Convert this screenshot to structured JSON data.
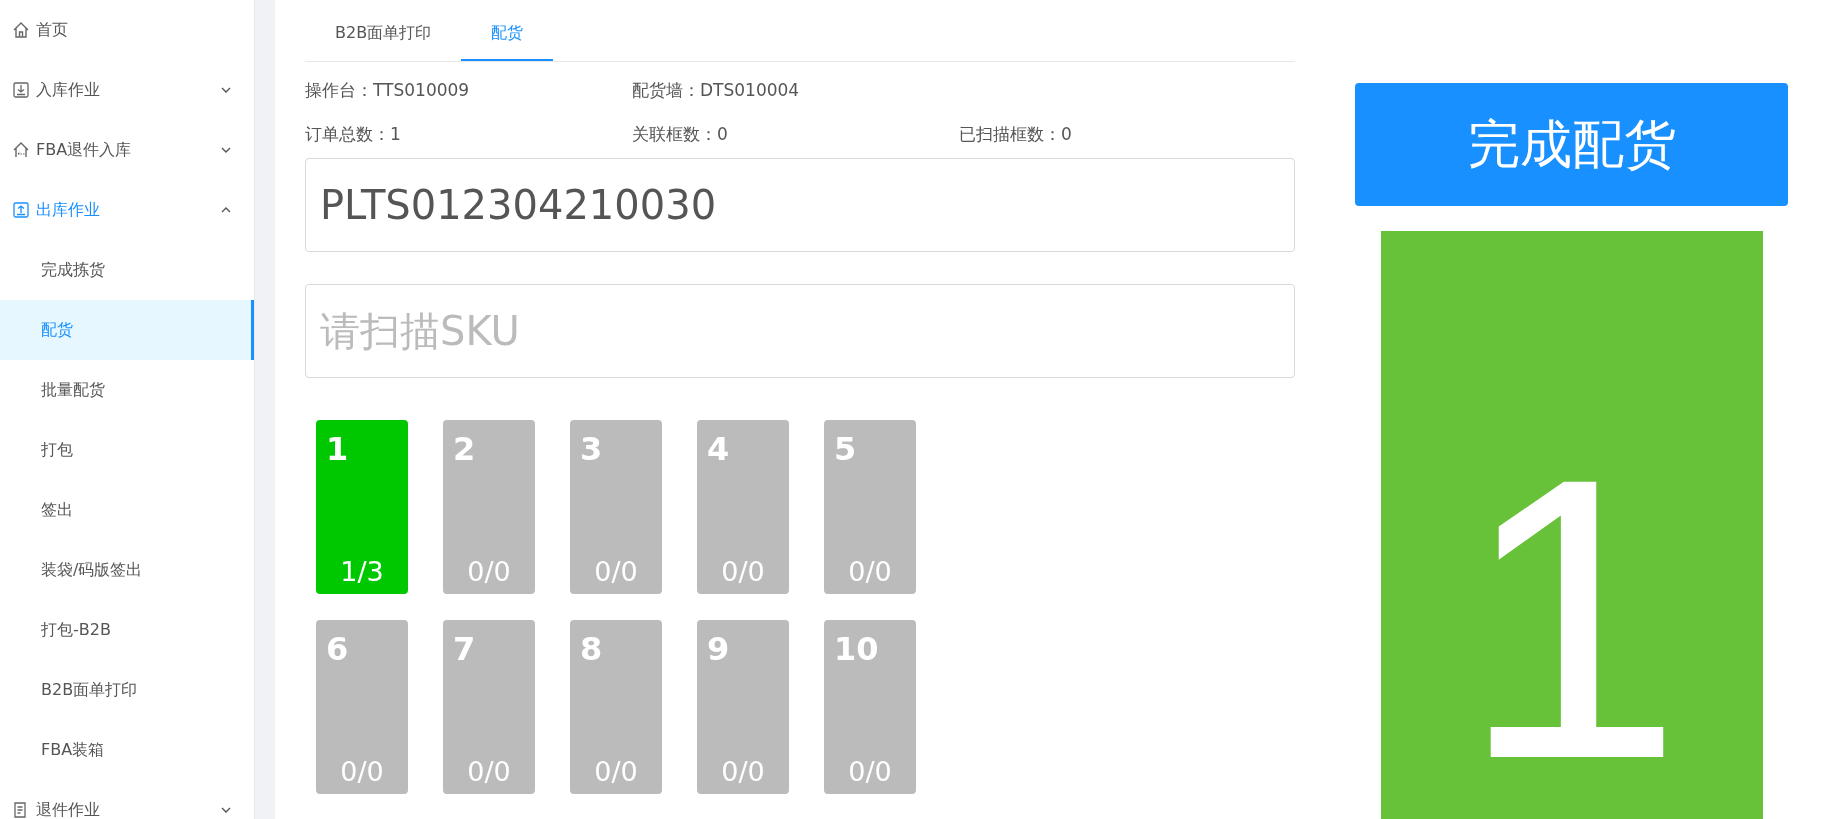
{
  "sidebar": {
    "items": [
      {
        "label": "首页",
        "kind": "link",
        "selected": false
      },
      {
        "label": "入库作业",
        "kind": "group",
        "expanded": false,
        "selected": false
      },
      {
        "label": "FBA退件入库",
        "kind": "group",
        "expanded": false,
        "selected": false
      },
      {
        "label": "出库作业",
        "kind": "group",
        "expanded": true,
        "selected": false,
        "children": [
          {
            "label": "完成拣货",
            "selected": false
          },
          {
            "label": "配货",
            "selected": true
          },
          {
            "label": "批量配货",
            "selected": false
          },
          {
            "label": "打包",
            "selected": false
          },
          {
            "label": "签出",
            "selected": false
          },
          {
            "label": "装袋/码版签出",
            "selected": false
          },
          {
            "label": "打包-B2B",
            "selected": false
          },
          {
            "label": "B2B面单打印",
            "selected": false
          },
          {
            "label": "FBA装箱",
            "selected": false
          }
        ]
      },
      {
        "label": "退件作业",
        "kind": "group",
        "expanded": false,
        "selected": false
      }
    ]
  },
  "tabs": [
    {
      "label": "B2B面单打印",
      "selected": false
    },
    {
      "label": "配货",
      "selected": true
    }
  ],
  "info": [
    [
      {
        "label": "操作台：",
        "value": "TTS010009"
      },
      {
        "label": "配货墙：",
        "value": "DTS010004"
      }
    ],
    [
      {
        "label": "订单总数：",
        "value": "1"
      },
      {
        "label": "关联框数：",
        "value": "0"
      },
      {
        "label": "已扫描框数：",
        "value": "0"
      }
    ]
  ],
  "container_field": {
    "value": "PLTS012304210030"
  },
  "sku_field": {
    "placeholder": "请扫描SKU"
  },
  "slots": [
    {
      "number": "1",
      "count": "1/3",
      "selected": true
    },
    {
      "number": "2",
      "count": "0/0",
      "selected": false
    },
    {
      "number": "3",
      "count": "0/0",
      "selected": false
    },
    {
      "number": "4",
      "count": "0/0",
      "selected": false
    },
    {
      "number": "5",
      "count": "0/0",
      "selected": false
    },
    {
      "number": "6",
      "count": "0/0",
      "selected": false
    },
    {
      "number": "7",
      "count": "0/0",
      "selected": false
    },
    {
      "number": "8",
      "count": "0/0",
      "selected": false
    },
    {
      "number": "9",
      "count": "0/0",
      "selected": false
    },
    {
      "number": "10",
      "count": "0/0",
      "selected": false
    }
  ],
  "finish_button": {
    "label": "完成配货"
  },
  "current_slot": {
    "number": "1"
  }
}
